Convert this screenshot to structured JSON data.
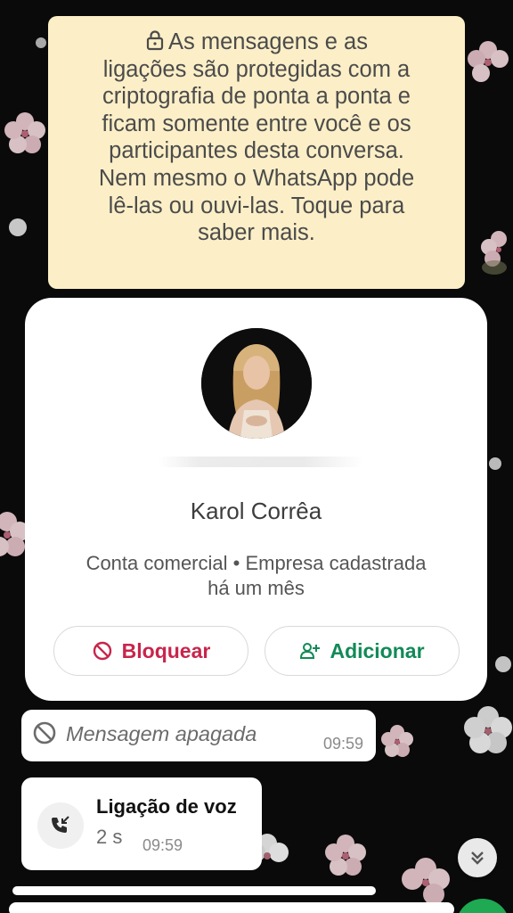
{
  "encryption_notice": {
    "lines": [
      "As mensagens e as",
      "ligações são protegidas com a",
      "criptografia de ponta a ponta e",
      "ficam somente entre você e os",
      "participantes desta conversa.",
      "Nem mesmo o WhatsApp pode",
      "lê-las ou ouvi-las. Toque para",
      "saber mais."
    ],
    "background": "#fcefc7"
  },
  "profile_card": {
    "name": "Karol Corrêa",
    "account_info_line1": "Conta comercial • Empresa cadastrada",
    "account_info_line2": "há um mês",
    "block_label": "Bloquear",
    "add_label": "Adicionar",
    "block_color": "#c8254b",
    "add_color": "#118a57"
  },
  "messages": {
    "deleted": {
      "text": "Mensagem apagada",
      "time": "09:59"
    },
    "call": {
      "title": "Ligação de voz",
      "duration": "2 s",
      "time": "09:59"
    }
  },
  "icons": {
    "lock": "lock-icon",
    "block": "block-icon",
    "add_contact": "add-contact-icon",
    "deleted": "deleted-icon",
    "incoming_call": "incoming-call-icon",
    "scroll_down": "double-chevron-down-icon"
  }
}
